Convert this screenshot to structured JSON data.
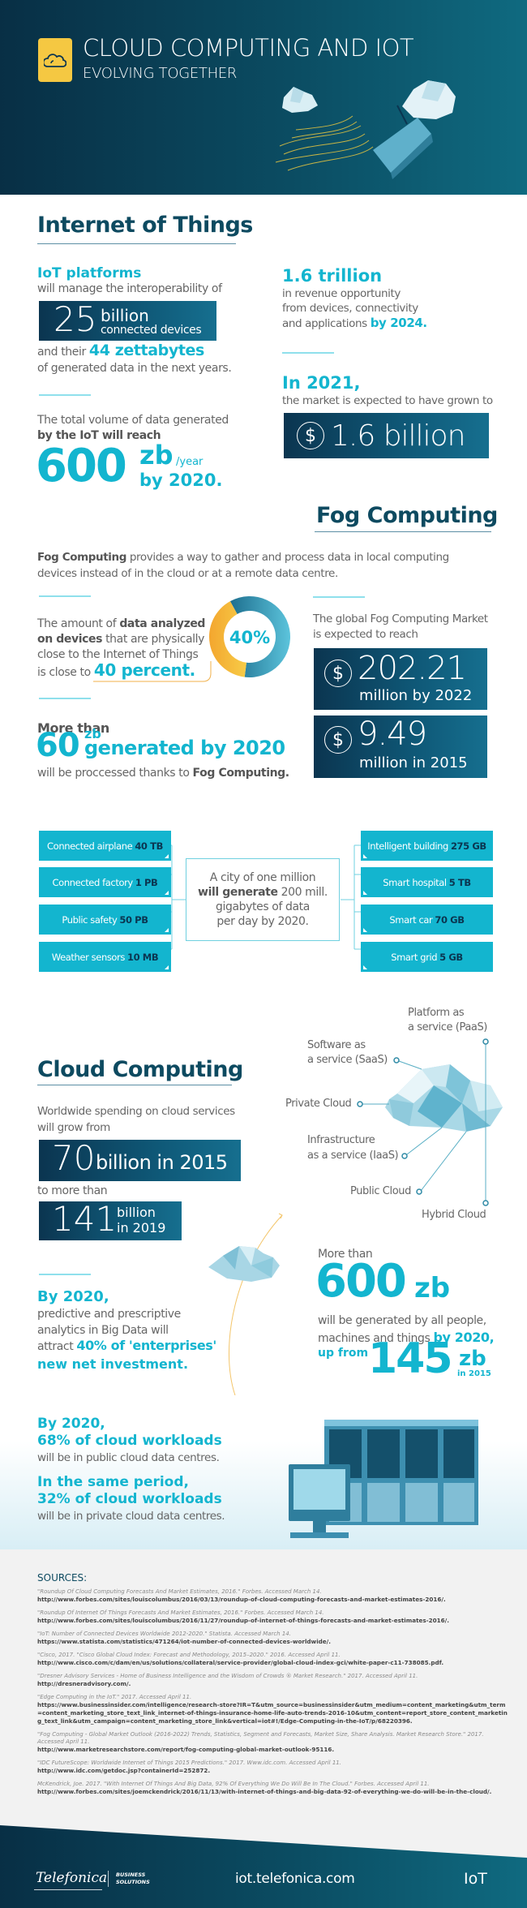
{
  "header": {
    "icon": "cloud-icon",
    "title": "CLOUD COMPUTING AND IOT",
    "subtitle": "EVOLVING TOGETHER"
  },
  "iot": {
    "section_title": "Internet of Things",
    "platforms_heading": "IoT platforms",
    "platforms_text": "will manage the interoperability of",
    "devices_number": "25",
    "devices_unit": "billion",
    "devices_label": "connected devices",
    "and_their": "and their",
    "zettabytes": "44 zettabytes",
    "generated_text": "of generated data in the next years.",
    "volume_text": "The total volume of data generated",
    "volume_bold": "by the IoT will reach",
    "volume_number": "600",
    "volume_unit": "zb",
    "volume_per": "/year",
    "volume_by": "by 2020.",
    "revenue_number": "1.6 trillion",
    "revenue_text_1": "in revenue opportunity",
    "revenue_text_2": "from devices, connectivity",
    "revenue_text_3": "and applications",
    "revenue_by": "by 2024.",
    "market_year": "In 2021,",
    "market_text": "the market is expected to have grown to",
    "market_currency": "$",
    "market_value": "1.6 billion"
  },
  "fog": {
    "section_title": "Fog Computing",
    "intro_bold": "Fog Computing",
    "intro_text": " provides a way to gather and process data in local computing devices instead of in the cloud or at a remote data centre.",
    "analyzed_1": "The amount of ",
    "analyzed_bold_1": "data analyzed",
    "analyzed_bold_2": "on devices",
    "analyzed_2": " that are physically",
    "analyzed_3": "close to the Internet of Things",
    "analyzed_4": "is close to",
    "analyzed_percent": "40 percent.",
    "donut_label": "40%",
    "donut_value": 0.4,
    "more_than": "More than",
    "processed_number": "60",
    "processed_unit": "zb",
    "processed_by": "generated by 2020",
    "processed_text": "will be proccessed thanks to ",
    "processed_bold": "Fog Computing.",
    "market_text_1": "The global Fog Computing Market",
    "market_text_2": "is expected to reach",
    "market_2022_value": "202.21",
    "market_2022_label": "million by 2022",
    "market_2015_value": "9.49",
    "market_2015_label": "million in 2015",
    "currency": "$"
  },
  "city": {
    "text_1": "A city of one million",
    "text_bold": "will generate",
    "text_2": " 200 mill.",
    "text_3": "gigabytes of data",
    "text_4": "per day by 2020.",
    "left_tiles": [
      {
        "label": "Connected airplane",
        "value": "40 TB"
      },
      {
        "label": "Connected factory",
        "value": "1 PB"
      },
      {
        "label": "Public safety",
        "value": "50 PB"
      },
      {
        "label": "Weather sensors",
        "value": "10 MB"
      }
    ],
    "right_tiles": [
      {
        "label": "Intelligent building",
        "value": "275 GB"
      },
      {
        "label": "Smart hospital",
        "value": "5 TB"
      },
      {
        "label": "Smart car",
        "value": "70 GB"
      },
      {
        "label": "Smart grid",
        "value": "5 GB"
      }
    ]
  },
  "cloud": {
    "section_title": "Cloud Computing",
    "spending_text_1": "Worldwide spending on cloud services",
    "spending_text_2": "will grow from",
    "from_number": "70",
    "from_label": "billion in 2015",
    "to_more_than": "to more than",
    "to_number": "141",
    "to_unit": "billion",
    "to_year": "in 2019",
    "services": {
      "paas": "Platform as a service (PaaS)",
      "paas_1": "Platform as",
      "paas_2": "a service (PaaS)",
      "saas_1": "Software as",
      "saas_2": "a service (SaaS)",
      "private": "Private Cloud",
      "iaas_1": "Infrastructure",
      "iaas_2": "as a service (IaaS)",
      "public": "Public Cloud",
      "hybrid": "Hybrid Cloud"
    },
    "analytics_year": "By 2020,",
    "analytics_1": "predictive and prescriptive",
    "analytics_2": "analytics in Big Data will",
    "analytics_3": "attract",
    "analytics_bold_1": "40% of 'enterprises'",
    "analytics_bold_2": "new net investment.",
    "data_more_than": "More than",
    "data_number": "600",
    "data_unit": "zb",
    "data_text_1": "will be generated by all people,",
    "data_text_2": "machines and things",
    "data_by": "by 2020,",
    "data_up_from": "up from",
    "data_prev_number": "145",
    "data_prev_unit": "zb",
    "data_prev_year": "in 2015",
    "workloads_year": "By 2020,",
    "workloads_public": "68% of cloud workloads",
    "workloads_public_text": "will be in public cloud data centres.",
    "workloads_period": "In the same period,",
    "workloads_private": "32% of cloud workloads",
    "workloads_private_text": "will be in private cloud data centres."
  },
  "sources": {
    "title": "SOURCES:",
    "items": [
      {
        "cite": "\"Roundup Of Cloud Computing Forecasts And Market Estimates, 2016.\" Forbes. Accessed March 14.",
        "url": "http://www.forbes.com/sites/louiscolumbus/2016/03/13/roundup-of-cloud-computing-forecasts-and-market-estimates-2016/."
      },
      {
        "cite": "\"Roundup Of Internet Of Things Forecasts And Market Estimates, 2016.\" Forbes. Accessed March 14.",
        "url": "http://www.forbes.com/sites/louiscolumbus/2016/11/27/roundup-of-internet-of-things-forecasts-and-market-estimates-2016/."
      },
      {
        "cite": "\"IoT: Number of Connected Devices Worldwide 2012-2020.\" Statista. Accessed March 14.",
        "url": "https://www.statista.com/statistics/471264/iot-number-of-connected-devices-worldwide/."
      },
      {
        "cite": "\"Cisco, 2017. \"Cisco Global Cloud Index: Forecast and Methodology, 2015–2020.\" 2016. Accessed April 11.",
        "url": "http://www.cisco.com/c/dam/en/us/solutions/collateral/service-provider/global-cloud-index-gci/white-paper-c11-738085.pdf."
      },
      {
        "cite": "\"Dresner Advisory Services - Home of Business Intelligence and the Wisdom of Crowds ® Market Research.\" 2017. Accessed April 11.",
        "url": "http://dresneradvisory.com/."
      },
      {
        "cite": "\"Edge Computing in the IoT.\" 2017. Accessed April 11.",
        "url": "https://www.businessinsider.com/intelligence/research-store?IR=T&utm_source=businessinsider&utm_medium=content_marketing&utm_term=content_marketing_store_text_link_internet-of-things-insurance-home-life-auto-trends-2016-10&utm_content=report_store_content_marketing_text_link&utm_campaign=content_marketing_store_link&vertical=iot#!/Edge-Computing-in-the-IoT/p/68220396."
      },
      {
        "cite": "\"Fog Computing - Global Market Outlook (2016-2022) Trends, Statistics, Segment and Forecasts, Market Size, Share Analysis. Market Research Store.\" 2017. Accessed April 11.",
        "url": "http://www.marketresearchstore.com/report/fog-computing-global-market-outlook-95116."
      },
      {
        "cite": "\"IDC FutureScope: Worldwide Internet of Things 2015 Predictions.\" 2017. Www.idc.com. Accessed April 11.",
        "url": "http://www.idc.com/getdoc.jsp?containerId=252872."
      },
      {
        "cite": "McKendrick, Joe. 2017. \"With Internet Of Things And Big Data, 92% Of Everything We Do Will Be In The Cloud.\" Forbes. Accessed April 11.",
        "url": "http://www.forbes.com/sites/joemckendrick/2016/11/13/with-internet-of-things-and-big-data-92-of-everything-we-do-will-be-in-the-cloud/."
      }
    ]
  },
  "footer": {
    "brand": "Telefonica",
    "brand_sub_1": "BUSINESS",
    "brand_sub_2": "SOLUTIONS",
    "url": "iot.telefonica.com",
    "tag": "IoT"
  }
}
